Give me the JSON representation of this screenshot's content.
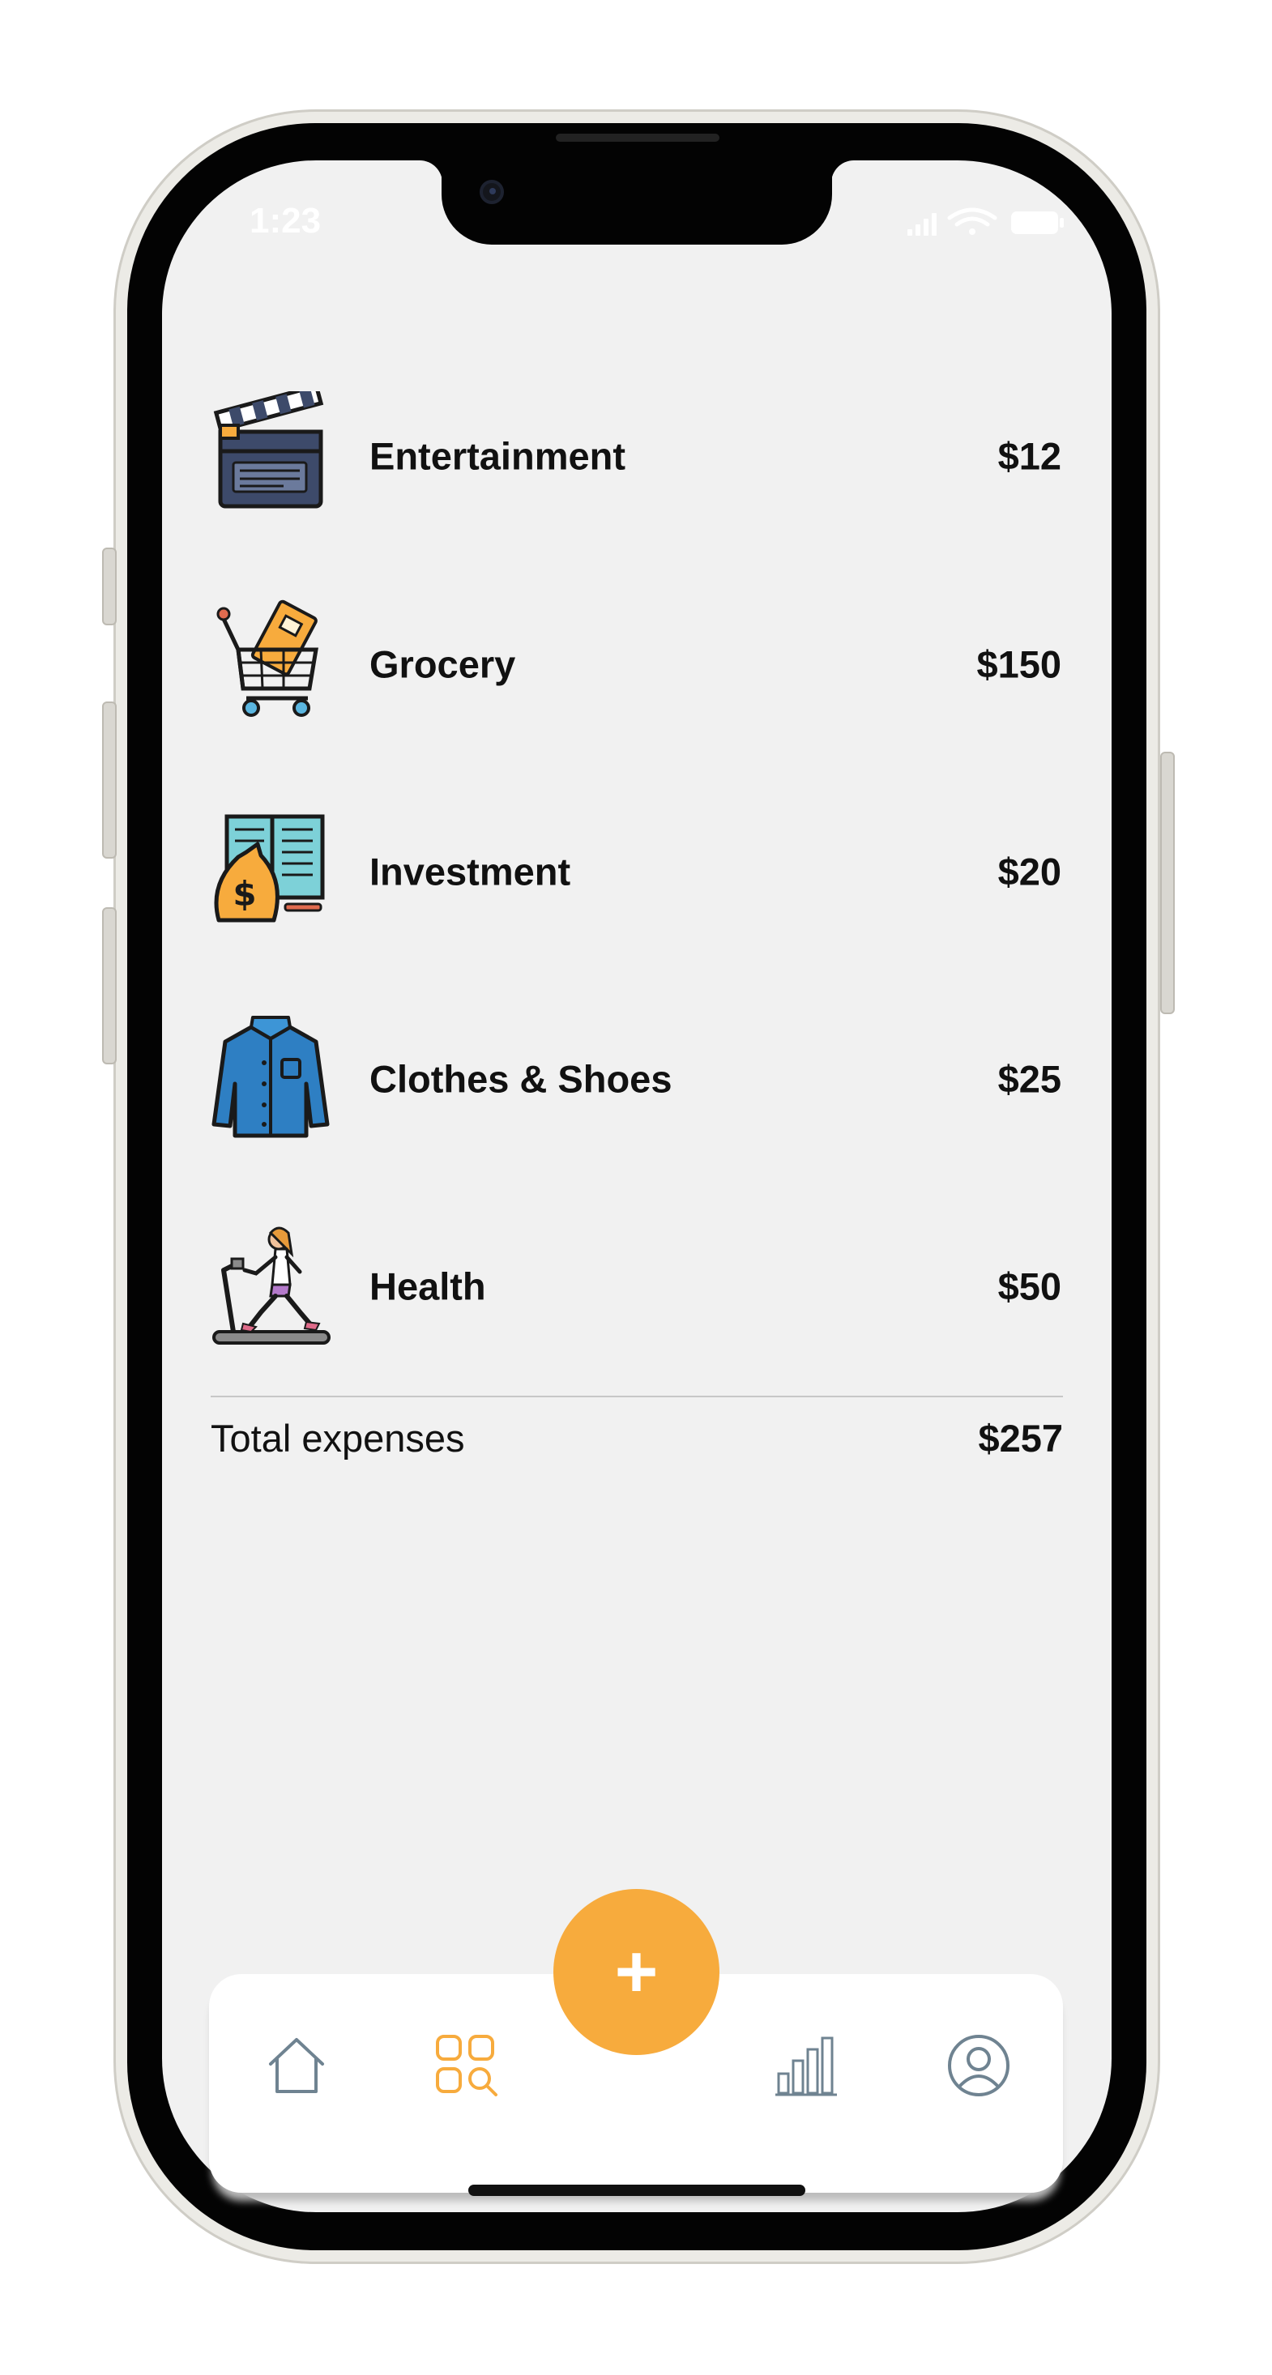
{
  "status_bar": {
    "time": "1:23",
    "icons": [
      "signal-icon",
      "wifi-icon",
      "battery-icon"
    ]
  },
  "categories": [
    {
      "name": "Entertainment",
      "amount": "$12",
      "icon": "clapperboard-icon"
    },
    {
      "name": "Grocery",
      "amount": "$150",
      "icon": "shopping-cart-icon"
    },
    {
      "name": "Investment",
      "amount": "$20",
      "icon": "money-bag-book-icon"
    },
    {
      "name": "Clothes & Shoes",
      "amount": "$25",
      "icon": "shirt-icon"
    },
    {
      "name": "Health",
      "amount": "$50",
      "icon": "treadmill-icon"
    }
  ],
  "total": {
    "label": "Total expenses",
    "amount": "$257"
  },
  "tabbar": {
    "fab_label": "+",
    "tabs": [
      {
        "name": "home",
        "icon": "home-icon",
        "active": false
      },
      {
        "name": "categories",
        "icon": "category-search-icon",
        "active": true
      },
      {
        "name": "stats",
        "icon": "bar-chart-icon",
        "active": false
      },
      {
        "name": "profile",
        "icon": "user-icon",
        "active": false
      }
    ]
  },
  "colors": {
    "accent": "#f7ab3d",
    "inactive_icon": "#6f8391",
    "background": "#f1f1f1",
    "text": "#111111"
  }
}
